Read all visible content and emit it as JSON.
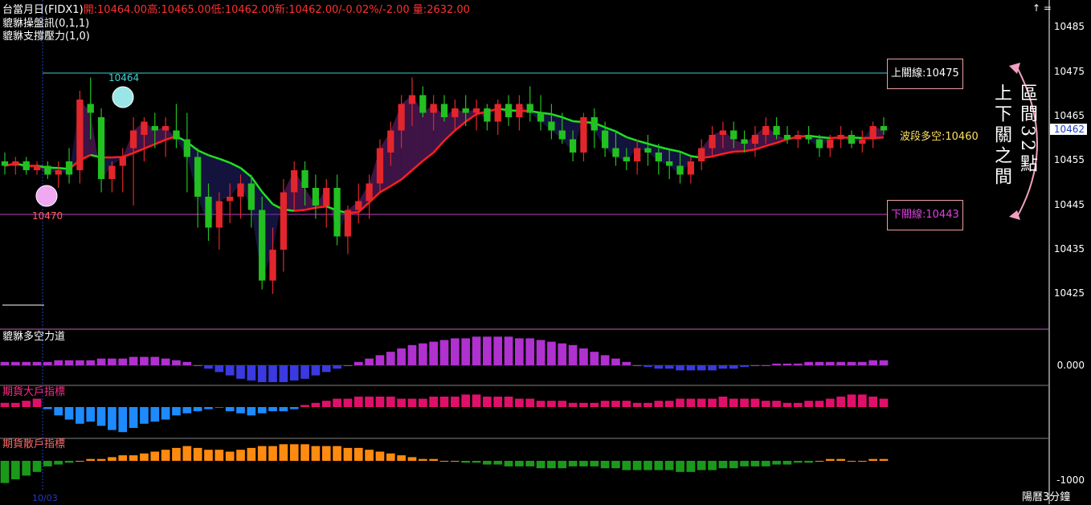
{
  "header": {
    "title": "台當月日(FIDX1)",
    "ohlc": "開:10464.00高:10465.00低:10462.00新:10462.00/-0.02%/-2.00 量:2632.00",
    "indicator1": "貔貅操盤訊(0,1,1)",
    "indicator2": "貔貅支撐壓力(1,0)"
  },
  "colors": {
    "up": "#e2262b",
    "down": "#22c020",
    "ma_down": "#ff1e1e",
    "ma_up": "#20e020",
    "upper_line": "#40d0d0",
    "lower_line": "#c040c0",
    "box_border": "#f0a0a0"
  },
  "levels": {
    "upper_label": "上關線:10475",
    "lower_label": "下關線:10443",
    "trend_label": "波段多空:10460",
    "marker_high": "10464",
    "marker_low": "10470"
  },
  "annotation": {
    "col1": "區間32點",
    "col2": "上下關之間"
  },
  "price_axis": {
    "ticks": [
      "10485",
      "10475",
      "10465",
      "10455",
      "10445",
      "10435",
      "10425"
    ],
    "current": "10462"
  },
  "panels": {
    "p1_title": "貔貅多空力道",
    "p1_tick": "0.000",
    "p2_title": "期貨大戶指標",
    "p3_title": "期貨散戶指標",
    "p3_tick": "-1000"
  },
  "footer": {
    "date": "10/03",
    "period": "陽曆3分鐘"
  },
  "chart_data": [
    {
      "type": "candlestick",
      "ylim": [
        10420,
        10490
      ],
      "ohlc": [
        [
          10455,
          10457,
          10452,
          10454
        ],
        [
          10454,
          10456,
          10452,
          10455
        ],
        [
          10455,
          10456,
          10452,
          10453
        ],
        [
          10453,
          10455,
          10452,
          10454
        ],
        [
          10454,
          10455,
          10451,
          10452
        ],
        [
          10452,
          10455,
          10449,
          10453
        ],
        [
          10455,
          10458,
          10450,
          10452
        ],
        [
          10453,
          10471,
          10450,
          10469
        ],
        [
          10468,
          10474,
          10460,
          10466
        ],
        [
          10465,
          10467,
          10448,
          10451
        ],
        [
          10451,
          10455,
          10448,
          10454
        ],
        [
          10454,
          10458,
          10448,
          10456
        ],
        [
          10458,
          10465,
          10445,
          10462
        ],
        [
          10461,
          10465,
          10455,
          10464
        ],
        [
          10463,
          10466,
          10458,
          10462
        ],
        [
          10462,
          10465,
          10456,
          10463
        ],
        [
          10462,
          10468,
          10458,
          10460
        ],
        [
          10460,
          10466,
          10448,
          10456
        ],
        [
          10456,
          10458,
          10440,
          10447
        ],
        [
          10447,
          10450,
          10437,
          10440
        ],
        [
          10440,
          10448,
          10435,
          10446
        ],
        [
          10446,
          10450,
          10441,
          10447
        ],
        [
          10447,
          10452,
          10442,
          10450
        ],
        [
          10450,
          10452,
          10440,
          10444
        ],
        [
          10444,
          10447,
          10426,
          10428
        ],
        [
          10428,
          10440,
          10425,
          10435
        ],
        [
          10435,
          10451,
          10430,
          10448
        ],
        [
          10448,
          10455,
          10444,
          10453
        ],
        [
          10453,
          10455,
          10445,
          10449
        ],
        [
          10449,
          10452,
          10442,
          10445
        ],
        [
          10445,
          10451,
          10440,
          10449
        ],
        [
          10449,
          10452,
          10436,
          10438
        ],
        [
          10438,
          10445,
          10434,
          10444
        ],
        [
          10444,
          10450,
          10441,
          10446
        ],
        [
          10446,
          10452,
          10442,
          10450
        ],
        [
          10450,
          10460,
          10448,
          10458
        ],
        [
          10457,
          10464,
          10454,
          10462
        ],
        [
          10462,
          10470,
          10458,
          10468
        ],
        [
          10468,
          10474,
          10463,
          10470
        ],
        [
          10470,
          10472,
          10465,
          10466
        ],
        [
          10466,
          10470,
          10462,
          10468
        ],
        [
          10468,
          10470,
          10464,
          10465
        ],
        [
          10465,
          10469,
          10462,
          10467
        ],
        [
          10467,
          10470,
          10463,
          10466
        ],
        [
          10466,
          10469,
          10462,
          10467
        ],
        [
          10467,
          10468,
          10462,
          10464
        ],
        [
          10464,
          10469,
          10461,
          10468
        ],
        [
          10468,
          10470,
          10463,
          10465
        ],
        [
          10465,
          10470,
          10462,
          10468
        ],
        [
          10468,
          10472,
          10464,
          10466
        ],
        [
          10466,
          10470,
          10462,
          10464
        ],
        [
          10464,
          10468,
          10460,
          10462
        ],
        [
          10462,
          10466,
          10459,
          10460
        ],
        [
          10460,
          10462,
          10455,
          10457
        ],
        [
          10457,
          10466,
          10455,
          10465
        ],
        [
          10465,
          10467,
          10458,
          10462
        ],
        [
          10462,
          10464,
          10456,
          10458
        ],
        [
          10458,
          10462,
          10454,
          10456
        ],
        [
          10456,
          10458,
          10453,
          10455
        ],
        [
          10455,
          10460,
          10452,
          10458
        ],
        [
          10458,
          10461,
          10454,
          10457
        ],
        [
          10457,
          10459,
          10452,
          10455
        ],
        [
          10455,
          10458,
          10451,
          10454
        ],
        [
          10454,
          10457,
          10450,
          10452
        ],
        [
          10452,
          10456,
          10450,
          10455
        ],
        [
          10455,
          10460,
          10453,
          10458
        ],
        [
          10458,
          10463,
          10456,
          10461
        ],
        [
          10461,
          10464,
          10458,
          10462
        ],
        [
          10462,
          10464,
          10458,
          10460
        ],
        [
          10460,
          10462,
          10457,
          10459
        ],
        [
          10459,
          10463,
          10456,
          10461
        ],
        [
          10461,
          10465,
          10459,
          10463
        ],
        [
          10463,
          10465,
          10460,
          10461
        ],
        [
          10461,
          10463,
          10459,
          10460
        ],
        [
          10460,
          10462,
          10458,
          10461
        ],
        [
          10461,
          10463,
          10459,
          10460
        ],
        [
          10460,
          10461,
          10456,
          10458
        ],
        [
          10458,
          10461,
          10456,
          10460
        ],
        [
          10460,
          10463,
          10458,
          10461
        ],
        [
          10461,
          10462,
          10458,
          10459
        ],
        [
          10459,
          10462,
          10457,
          10460
        ],
        [
          10460,
          10464,
          10458,
          10463
        ],
        [
          10463,
          10465,
          10461,
          10462
        ]
      ]
    },
    {
      "type": "bar",
      "title": "貔貅多空力道",
      "values": [
        2,
        2,
        2,
        2,
        2,
        3,
        3,
        3,
        3,
        4,
        4,
        4,
        5,
        5,
        5,
        4,
        3,
        2,
        0,
        -2,
        -4,
        -6,
        -8,
        -9,
        -10,
        -10,
        -10,
        -9,
        -8,
        -6,
        -4,
        -2,
        0,
        2,
        4,
        6,
        8,
        10,
        12,
        13,
        14,
        15,
        16,
        16,
        17,
        17,
        17,
        17,
        16,
        16,
        15,
        14,
        13,
        12,
        10,
        8,
        6,
        4,
        2,
        0,
        -1,
        -2,
        -2,
        -3,
        -3,
        -3,
        -3,
        -2,
        -2,
        -1,
        0,
        0,
        1,
        1,
        1,
        2,
        2,
        2,
        2,
        2,
        2,
        3,
        3
      ]
    },
    {
      "type": "bar",
      "title": "期貨大戶指標",
      "values": [
        2,
        2,
        3,
        4,
        -1,
        -4,
        -6,
        -8,
        -7,
        -9,
        -11,
        -12,
        -10,
        -8,
        -7,
        -6,
        -4,
        -3,
        -2,
        -1,
        0,
        -2,
        -3,
        -4,
        -3,
        -2,
        -2,
        -1,
        1,
        2,
        3,
        4,
        4,
        5,
        5,
        5,
        5,
        4,
        4,
        4,
        5,
        5,
        5,
        6,
        6,
        5,
        5,
        5,
        4,
        4,
        3,
        3,
        3,
        2,
        2,
        2,
        3,
        3,
        3,
        2,
        2,
        3,
        3,
        4,
        4,
        4,
        4,
        5,
        4,
        4,
        4,
        3,
        3,
        2,
        2,
        3,
        3,
        4,
        5,
        6,
        6,
        5,
        4
      ]
    },
    {
      "type": "bar",
      "title": "期貨散戶指標",
      "values": [
        -12,
        -10,
        -8,
        -6,
        -3,
        -2,
        -1,
        0,
        1,
        1,
        2,
        3,
        3,
        4,
        5,
        6,
        7,
        8,
        7,
        6,
        6,
        5,
        6,
        7,
        8,
        8,
        9,
        9,
        9,
        8,
        8,
        8,
        7,
        7,
        6,
        5,
        4,
        3,
        2,
        1,
        1,
        0,
        0,
        -1,
        -1,
        -2,
        -2,
        -3,
        -3,
        -3,
        -4,
        -4,
        -4,
        -3,
        -3,
        -3,
        -4,
        -4,
        -5,
        -5,
        -5,
        -5,
        -5,
        -6,
        -6,
        -5,
        -5,
        -4,
        -4,
        -3,
        -3,
        -3,
        -2,
        -2,
        -1,
        -1,
        0,
        1,
        1,
        0,
        0,
        1,
        1
      ]
    }
  ]
}
